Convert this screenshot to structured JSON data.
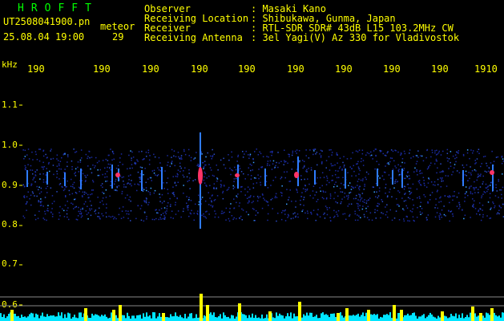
{
  "header": {
    "logo": "HROFFT",
    "filename": "UT2508041900.pn",
    "meteor_label": "meteor",
    "datetime": "25.08.04 19:00",
    "count": "29",
    "info_labels": [
      "Observer",
      "Receiving Location",
      "Receiver",
      "Receiving Antenna"
    ],
    "info_values": [
      ": Masaki Kano",
      ": Shibukawa, Gunma, Japan",
      ": RTL-SDR SDR# 43dB L15 103.2MHz CW",
      ": 3el Yagi(V) Az 330 for Vladivostok"
    ]
  },
  "axis": {
    "unit": "kHz",
    "y_ticks": [
      "1.1",
      "1.0",
      "0.9",
      "0.8",
      "0.7",
      "0.6"
    ],
    "x_ticks": [
      "190",
      "190",
      "190",
      "190",
      "190",
      "190",
      "190",
      "190",
      "190",
      "1910"
    ]
  },
  "colors": {
    "text": "#ffff00",
    "logo": "#00ff00",
    "background": "#000000",
    "noise": "#1a2aa0",
    "meteor_core": "#ff3366",
    "count_bars": "#ffff00",
    "baseline": "#00e5ff"
  }
}
